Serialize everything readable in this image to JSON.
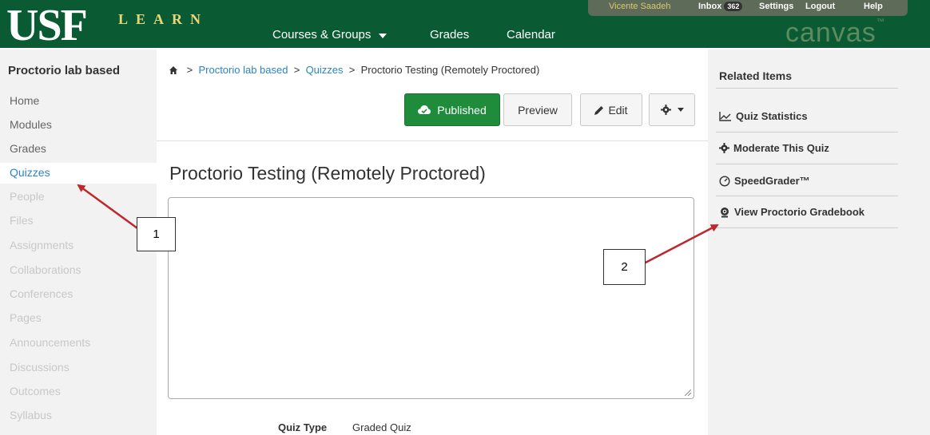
{
  "header": {
    "logo_usf": "USF",
    "logo_learn": "LEARN",
    "nav": [
      "Courses & Groups",
      "Grades",
      "Calendar"
    ],
    "user": "Vicente Saadeh",
    "inbox_label": "Inbox",
    "inbox_count": "362",
    "settings": "Settings",
    "logout": "Logout",
    "help": "Help",
    "brand": "canvas",
    "brand_tm": "™",
    "brand_color": "#0a5b33"
  },
  "sidebar": {
    "course_title": "Proctorio lab based",
    "items": [
      {
        "label": "Home"
      },
      {
        "label": "Modules"
      },
      {
        "label": "Grades"
      },
      {
        "label": "Quizzes"
      },
      {
        "label": "People"
      },
      {
        "label": "Files"
      },
      {
        "label": "Assignments"
      },
      {
        "label": "Collaborations"
      },
      {
        "label": "Conferences"
      },
      {
        "label": "Pages"
      },
      {
        "label": "Announcements"
      },
      {
        "label": "Discussions"
      },
      {
        "label": "Outcomes"
      },
      {
        "label": "Syllabus"
      }
    ]
  },
  "breadcrumb": {
    "course": "Proctorio lab based",
    "section": "Quizzes",
    "current": "Proctorio Testing (Remotely Proctored)"
  },
  "toolbar": {
    "published": "Published",
    "preview": "Preview",
    "edit": "Edit"
  },
  "quiz": {
    "title": "Proctorio Testing (Remotely Proctored)",
    "quiz_type_label": "Quiz Type",
    "quiz_type_value": "Graded Quiz"
  },
  "related": {
    "title": "Related Items",
    "items": [
      {
        "label": "Quiz Statistics",
        "icon": "chart-icon"
      },
      {
        "label": "Moderate This Quiz",
        "icon": "gear-icon"
      },
      {
        "label": "SpeedGrader™",
        "icon": "speedometer-icon"
      },
      {
        "label": "View Proctorio Gradebook",
        "icon": "webcam-icon"
      }
    ]
  },
  "callouts": [
    "1",
    "2"
  ]
}
